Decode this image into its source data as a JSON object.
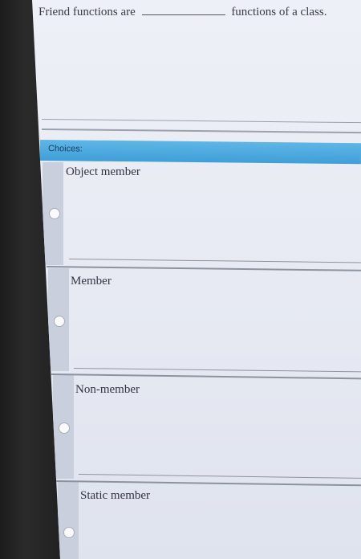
{
  "question": {
    "before_blank": "Friend functions are",
    "after_blank": "functions of a class."
  },
  "choices_header": "Choices:",
  "choices": [
    {
      "label": "Object member"
    },
    {
      "label": "Member"
    },
    {
      "label": "Non-member"
    },
    {
      "label": "Static member"
    }
  ],
  "colors": {
    "header_bar": "#4aa8dd",
    "background": "#e8ebf3",
    "bezel": "#222222"
  }
}
